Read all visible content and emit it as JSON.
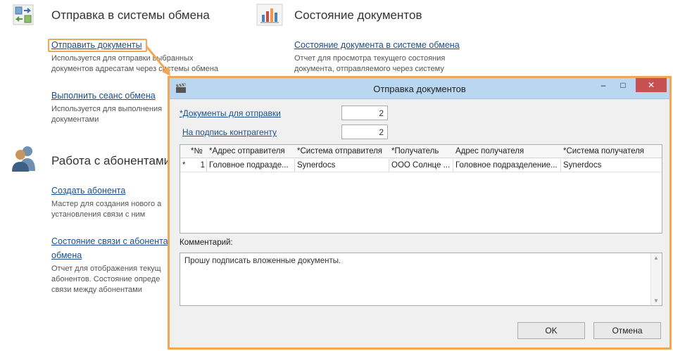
{
  "background": {
    "send_section": {
      "title": "Отправка в системы обмена",
      "icon": "exchange-arrows-icon",
      "items": [
        {
          "link": "Отправить документы",
          "desc": [
            "Используется для отправки выбранных",
            "документов адресатам через системы обмена"
          ]
        },
        {
          "link": "Выполнить сеанс обмена",
          "desc": [
            "Используется для выполнения",
            "документами"
          ]
        }
      ]
    },
    "status_section": {
      "title": "Состояние документов",
      "icon": "bar-chart-icon",
      "items": [
        {
          "link": "Состояние документа в системе обмена",
          "desc": [
            "Отчет для просмотра текущего состояния",
            "документа, отправляемого через систему"
          ]
        }
      ]
    },
    "subscribers_section": {
      "title": "Работа с абонентами",
      "icon": "users-icon",
      "items": [
        {
          "link": "Создать абонента",
          "desc": [
            "Мастер для создания нового а",
            "установления связи с ним"
          ]
        },
        {
          "link": "Состояние связи с абонента",
          "link2": "обмена",
          "desc": [
            "Отчет для отображения текущ",
            "абонентов. Состояние опреде",
            "связи между абонентами"
          ]
        }
      ]
    }
  },
  "dialog": {
    "title": "Отправка документов",
    "title_icon": "clapperboard-icon",
    "minimize": "–",
    "maximize": "□",
    "close": "✕",
    "docs_label": "*Документы для отправки",
    "docs_value": "2",
    "sign_label": "На подпись контрагенту",
    "sign_value": "2",
    "table": {
      "columns": [
        "*№",
        "*Адрес отправителя",
        "*Система отправителя",
        "*Получатель",
        "Адрес получателя",
        "*Система получателя"
      ],
      "rows": [
        {
          "marker": "*",
          "cells": [
            "1",
            "Головное подразде...",
            "Synerdocs",
            "ООО Солнце ...",
            "Головное подразделение...",
            "Synerdocs"
          ]
        }
      ]
    },
    "comment_label": "Комментарий:",
    "comment_value": "Прошу подписать вложенные документы.",
    "ok_label": "OK",
    "cancel_label": "Отмена"
  },
  "colors": {
    "highlight": "#f0a858",
    "link": "#1a4f8b",
    "titlebar": "#b9d7f1",
    "close_button": "#c75050"
  }
}
